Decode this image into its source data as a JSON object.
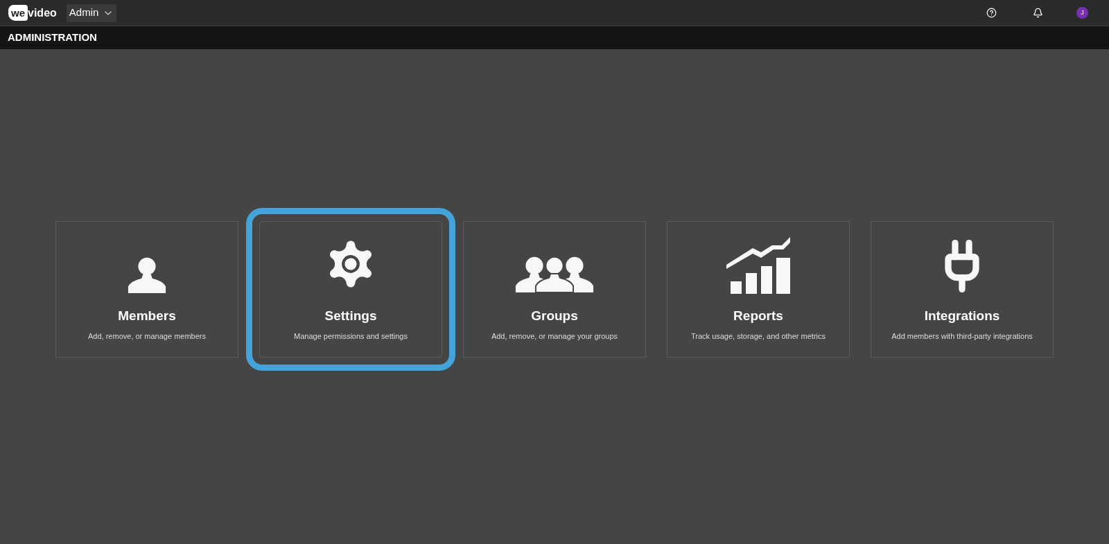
{
  "topbar": {
    "logo": {
      "badge": "we",
      "text": "video"
    },
    "account_menu": "Admin",
    "avatar": "J"
  },
  "title": "ADMINISTRATION",
  "cards": [
    {
      "kind": "person",
      "title": "Members",
      "description": "Add, remove, or manage members",
      "highlighted": false
    },
    {
      "kind": "gear",
      "title": "Settings",
      "description": "Manage permissions and settings",
      "highlighted": true
    },
    {
      "kind": "people",
      "title": "Groups",
      "description": "Add, remove, or manage your groups",
      "highlighted": false
    },
    {
      "kind": "chart",
      "title": "Reports",
      "description": "Track usage, storage, and other metrics",
      "highlighted": false
    },
    {
      "kind": "plug",
      "title": "Integrations",
      "description": "Add members with third-party integrations",
      "highlighted": false
    }
  ]
}
